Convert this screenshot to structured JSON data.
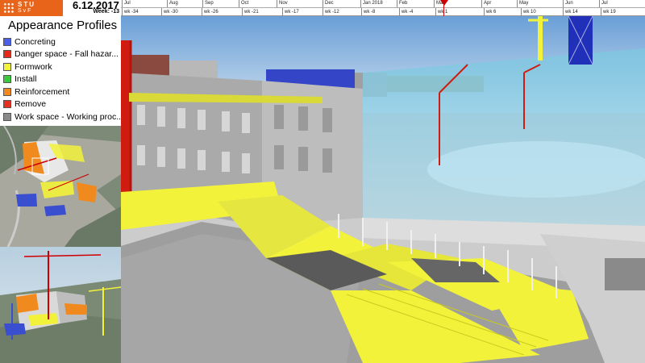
{
  "logo": {
    "line1": "STU",
    "line2": "SvF"
  },
  "status": {
    "date": "6.12.2017",
    "week": "Week: -13"
  },
  "timeline": {
    "months": [
      "Jul",
      "Aug",
      "Sep",
      "Oct",
      "Nov",
      "Dec",
      "Jan 2018",
      "Feb",
      "Mar",
      "Apr",
      "May",
      "Jun",
      "Jul"
    ],
    "weeks": [
      "wk -34",
      "wk -30",
      "wk -26",
      "wk -21",
      "wk -17",
      "wk -12",
      "wk -8",
      "wk -4",
      "wk 1",
      "wk 6",
      "wk 10",
      "wk 14",
      "wk 19"
    ]
  },
  "legend": {
    "title": "Appearance Profiles",
    "items": [
      {
        "label": "Concreting",
        "color": "#4a5ee8"
      },
      {
        "label": "Danger space - Fall hazar...",
        "color": "#e62a1a"
      },
      {
        "label": "Formwork",
        "color": "#f2f23a"
      },
      {
        "label": "Install",
        "color": "#3cc83c"
      },
      {
        "label": "Reinforcement",
        "color": "#f08a1e"
      },
      {
        "label": "Remove",
        "color": "#e63020"
      },
      {
        "label": "Work space - Working proc...",
        "color": "#8a8a8a"
      }
    ]
  }
}
